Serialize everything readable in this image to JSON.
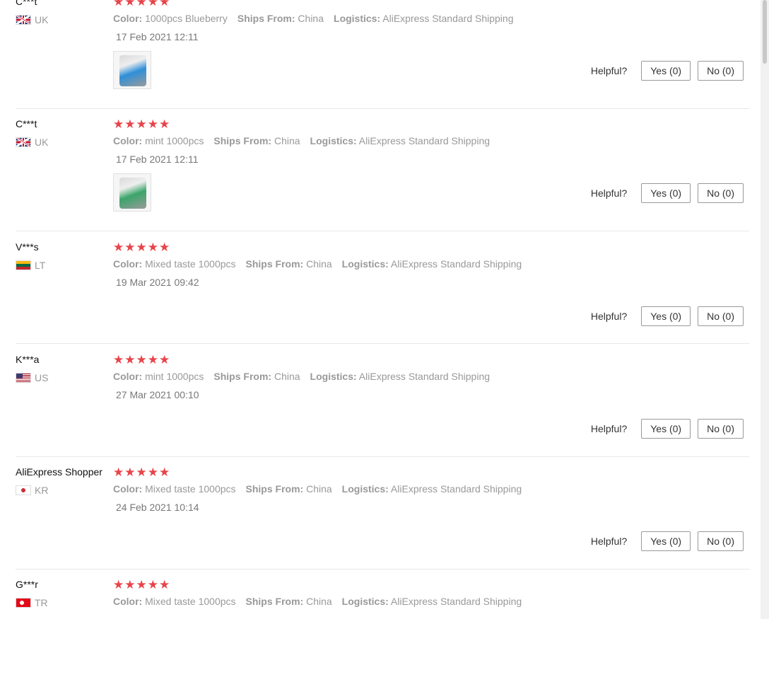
{
  "labels": {
    "color": "Color:",
    "ships_from": "Ships From:",
    "logistics": "Logistics:",
    "helpful": "Helpful?",
    "yes": "Yes (0)",
    "no": "No (0)"
  },
  "reviews": [
    {
      "name": "C***t",
      "country": "UK",
      "stars": "★★★★★",
      "color": "1000pcs Blueberry",
      "ships_from": "China",
      "logistics": "AliExpress Standard Shipping",
      "date": "17 Feb 2021 12:11",
      "has_photo": true,
      "photo_tint": "#2f8fd8"
    },
    {
      "name": "C***t",
      "country": "UK",
      "stars": "★★★★★",
      "color": "mint 1000pcs",
      "ships_from": "China",
      "logistics": "AliExpress Standard Shipping",
      "date": "17 Feb 2021 12:11",
      "has_photo": true,
      "photo_tint": "#3aa56a"
    },
    {
      "name": "V***s",
      "country": "LT",
      "stars": "★★★★★",
      "color": "Mixed taste 1000pcs",
      "ships_from": "China",
      "logistics": "AliExpress Standard Shipping",
      "date": "19 Mar 2021 09:42",
      "has_photo": false
    },
    {
      "name": "K***a",
      "country": "US",
      "stars": "★★★★★",
      "color": "mint 1000pcs",
      "ships_from": "China",
      "logistics": "AliExpress Standard Shipping",
      "date": "27 Mar 2021 00:10",
      "has_photo": false
    },
    {
      "name": "AliExpress Shopper",
      "country": "KR",
      "stars": "★★★★★",
      "color": "Mixed taste 1000pcs",
      "ships_from": "China",
      "logistics": "AliExpress Standard Shipping",
      "date": "24 Feb 2021 10:14",
      "has_photo": false
    },
    {
      "name": "G***r",
      "country": "TR",
      "stars": "★★★★★",
      "color": "Mixed taste 1000pcs",
      "ships_from": "China",
      "logistics": "AliExpress Standard Shipping",
      "date": "",
      "has_photo": false
    }
  ]
}
